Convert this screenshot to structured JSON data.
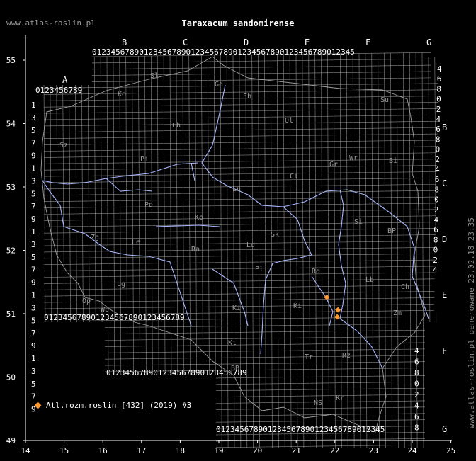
{
  "site_url": "www.atlas-roslin.pl",
  "title": "Taraxacum sandomirense",
  "generated_note": "www.atlas-roslin.pl generowane 23.02.18 23:35",
  "legend": {
    "label": "Atl.rozm.roslin [432] (2019) #3",
    "marker_color": "#ff9933"
  },
  "colors": {
    "background": "#000000",
    "grid": "#8c8c8c",
    "border": "#a0a0a0",
    "rivers": "#aab8ff",
    "axes": "#ffffff",
    "record": "#ff9933"
  },
  "x_axis": {
    "ticks": [
      "14",
      "15",
      "16",
      "17",
      "18",
      "19",
      "20",
      "21",
      "22",
      "23",
      "24",
      "25"
    ]
  },
  "y_axis": {
    "ticks": [
      "49",
      "50",
      "51",
      "52",
      "53",
      "54",
      "55"
    ]
  },
  "grid_letters_top": [
    "B",
    "C",
    "D",
    "E",
    "F",
    "G"
  ],
  "grid_letter_left_top": "A",
  "grid_letters_right": [
    "B",
    "C",
    "D",
    "E",
    "F",
    "G"
  ],
  "digit_row": "0123456789",
  "region_labels": [
    "Sl",
    "Gd",
    "Eb",
    "Ko",
    "Su",
    "Ch",
    "Ol",
    "Pi",
    "Bi",
    "Ci",
    "Gr",
    "Wr",
    "Sz",
    "Ko",
    "Ra",
    "Po",
    "Ld",
    "Sk",
    "Lu",
    "Rd",
    "Ki",
    "Ki",
    "Zg",
    "Le",
    "Pl",
    "Si",
    "BP",
    "Lb",
    "Ch",
    "Zm",
    "Lg",
    "Wb",
    "Op",
    "Kt",
    "Tr",
    "Rz",
    "BB",
    "NS",
    "Kr"
  ],
  "records": [
    {
      "lon": 21.79,
      "lat": 51.26
    },
    {
      "lon": 22.08,
      "lat": 51.06
    },
    {
      "lon": 22.06,
      "lat": 50.95
    }
  ]
}
